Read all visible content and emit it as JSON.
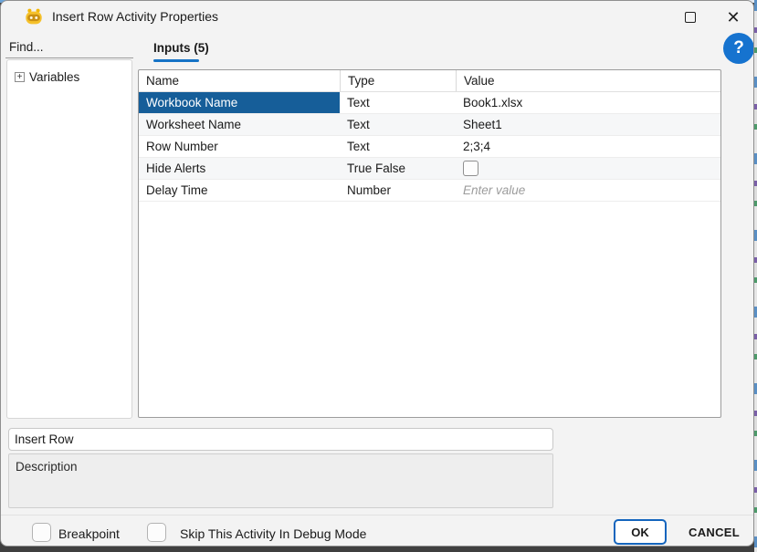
{
  "window": {
    "title": "Insert Row Activity Properties",
    "close_glyph": "✕",
    "help_glyph": "?"
  },
  "sidebar": {
    "find_placeholder": "Find...",
    "expand_glyph": "+",
    "tree": [
      {
        "label": "Variables"
      }
    ]
  },
  "tabs": [
    {
      "label": "Inputs (5)",
      "active": true
    }
  ],
  "table": {
    "columns": [
      "Name",
      "Type",
      "Value"
    ],
    "selected_row_index": 0,
    "rows": [
      {
        "name": "Workbook Name",
        "type": "Text",
        "value": "Book1.xlsx",
        "kind": "text",
        "selected": true
      },
      {
        "name": "Worksheet Name",
        "type": "Text",
        "value": "Sheet1",
        "kind": "text"
      },
      {
        "name": "Row Number",
        "type": "Text",
        "value": "2;3;4",
        "kind": "text"
      },
      {
        "name": "Hide Alerts",
        "type": "True False",
        "checked": false,
        "kind": "checkbox"
      },
      {
        "name": "Delay Time",
        "type": "Number",
        "placeholder": "Enter value",
        "kind": "placeholder"
      }
    ]
  },
  "name_field": {
    "value": "Insert Row"
  },
  "description_field": {
    "value": "Description"
  },
  "footer": {
    "breakpoint_label": "Breakpoint",
    "breakpoint_checked": false,
    "skip_label": "Skip This Activity In Debug Mode",
    "skip_checked": false,
    "ok_label": "OK",
    "cancel_label": "CANCEL"
  },
  "colors": {
    "selection": "#165E99",
    "accent": "#1673C6",
    "help_circle": "#1673CF",
    "ok_border": "#1465BD",
    "dialog_bg": "#F3F3F3"
  }
}
